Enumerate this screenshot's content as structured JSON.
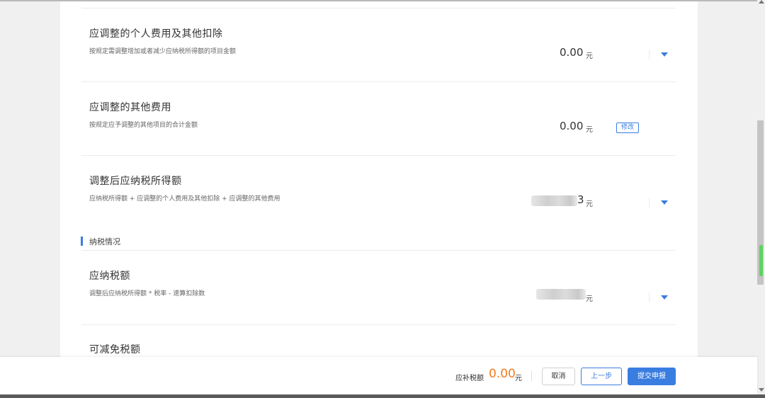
{
  "rows": [
    {
      "title": "应调整的个人费用及其他扣除",
      "desc": "按规定需调整增加或者减少应纳税所得额的项目金额",
      "amount": "0.00",
      "unit": "元",
      "control": "chevron-down-icon"
    },
    {
      "title": "应调整的其他费用",
      "desc": "按规定应予调整的其他项目的合计金额",
      "amount": "0.00",
      "unit": "元",
      "control_label": "修改"
    },
    {
      "title": "调整后应纳税所得额",
      "desc": "应纳税所得额 + 应调整的个人费用及其他扣除 + 应调整的其他费用",
      "amount_partial": "3",
      "unit": "元",
      "control": "chevron-down-icon"
    },
    {
      "title": "应纳税额",
      "desc": "调整后应纳税所得额 * 税率 - 速算扣除数",
      "unit": "元",
      "control": "chevron-down-icon"
    },
    {
      "title": "可减免税额"
    }
  ],
  "section": {
    "title": "纳税情况"
  },
  "footer": {
    "label": "应补税额",
    "amount": "0.00",
    "unit": "元",
    "cancel_label": "取消",
    "prev_label": "上一步",
    "submit_label": "提交申报"
  },
  "colors": {
    "accent": "#3a7de0",
    "amount_highlight": "#f47b20"
  }
}
